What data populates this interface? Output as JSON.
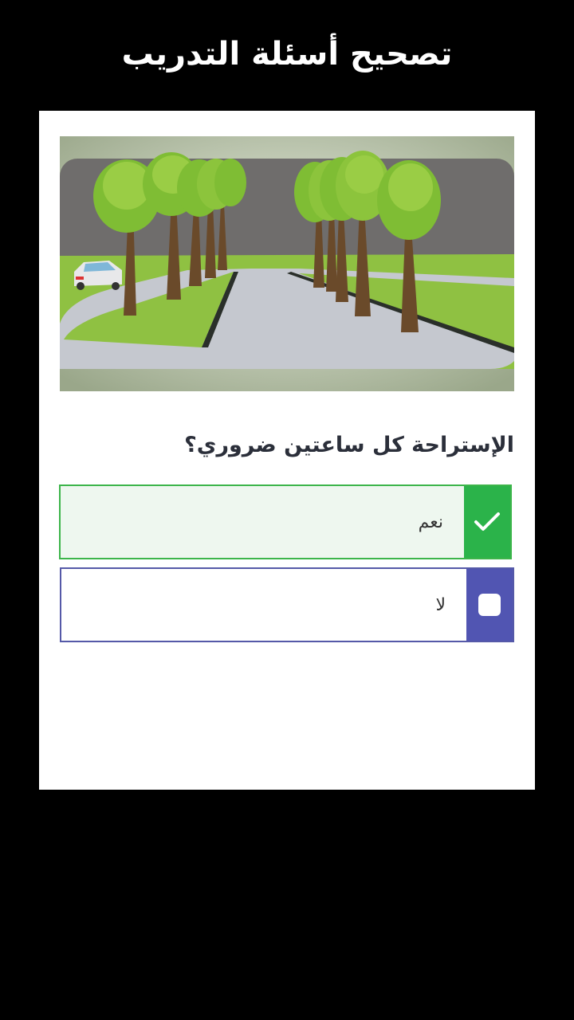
{
  "header": {
    "title": "تصحيح أسئلة التدريب"
  },
  "question": {
    "text": "الإستراحة كل ساعتين ضروري؟"
  },
  "options": [
    {
      "label": "نعم",
      "state": "correct",
      "marker_icon": "checkmark-icon"
    },
    {
      "label": "لا",
      "state": "unselected",
      "marker_icon": "checkbox-empty-icon"
    }
  ],
  "colors": {
    "correct_accent": "#2bb34a",
    "correct_bg": "#eef7ef",
    "neutral_accent": "#5155b2"
  }
}
